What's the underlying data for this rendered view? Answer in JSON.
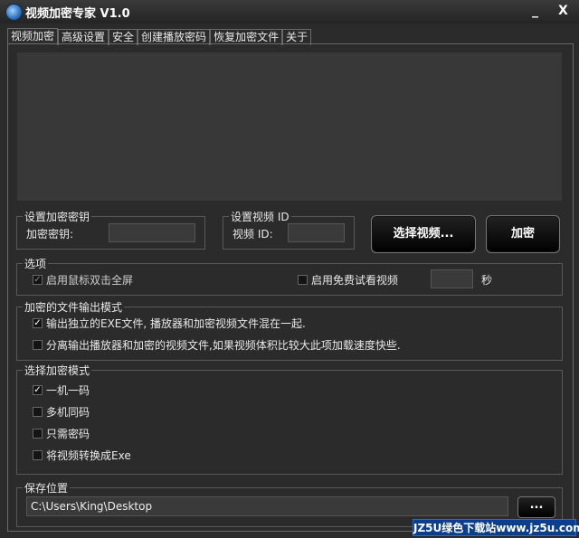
{
  "window": {
    "title": "视频加密专家 V1.0",
    "minimize_glyph": "_",
    "close_glyph": "X"
  },
  "tabs": [
    {
      "label": "视频加密",
      "active": true
    },
    {
      "label": "高级设置",
      "active": false
    },
    {
      "label": "安全",
      "active": false
    },
    {
      "label": "创建播放密码",
      "active": false
    },
    {
      "label": "恢复加密文件",
      "active": false
    },
    {
      "label": "关于",
      "active": false
    }
  ],
  "key_group": {
    "legend": "设置加密密钥",
    "label": "加密密钥:",
    "value": ""
  },
  "video_id_group": {
    "legend": "设置视频 ID",
    "label": "视频 ID:",
    "value": ""
  },
  "buttons": {
    "select_video": "选择视频...",
    "encrypt": "加密",
    "browse": "..."
  },
  "options": {
    "legend": "选项",
    "fullscreen_dblclick": {
      "label": "启用鼠标双击全屏",
      "checked": true,
      "disabled": true
    },
    "free_trial": {
      "label": "启用免费试看视频",
      "checked": false
    },
    "trial_seconds": "",
    "seconds_unit": "秒"
  },
  "output_mode": {
    "legend": "加密的文件输出模式",
    "items": [
      {
        "label": "输出独立的EXE文件, 播放器和加密视频文件混在一起.",
        "checked": true
      },
      {
        "label": "分离输出播放器和加密的视频文件,如果视频体积比较大此项加载速度快些.",
        "checked": false
      }
    ]
  },
  "encrypt_mode": {
    "legend": "选择加密模式",
    "items": [
      {
        "label": "一机一码",
        "checked": true
      },
      {
        "label": "多机同码",
        "checked": false
      },
      {
        "label": "只需密码",
        "checked": false
      },
      {
        "label": "将视频转换成Exe",
        "checked": false
      }
    ]
  },
  "save": {
    "legend": "保存位置",
    "path": "C:\\Users\\King\\Desktop"
  },
  "watermark": "JZ5U绿色下载站www.jz5u.com",
  "colors": {
    "background": "#2b2b2b",
    "preview": "#383838",
    "watermark": "#0b3f8a"
  }
}
